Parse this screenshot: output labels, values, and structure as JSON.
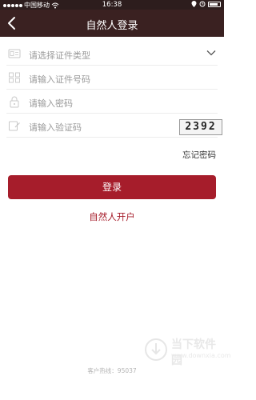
{
  "status_bar": {
    "carrier": "中国移动",
    "time": "16:38"
  },
  "header": {
    "title": "自然人登录"
  },
  "form": {
    "id_type_placeholder": "请选择证件类型",
    "id_number_placeholder": "请输入证件号码",
    "password_placeholder": "请输入密码",
    "captcha_placeholder": "请输入验证码",
    "captcha_code": "2392"
  },
  "links": {
    "forgot_password": "忘记密码",
    "open_account": "自然人开户"
  },
  "buttons": {
    "login": "登录"
  },
  "footer": {
    "hotline": "客户热线：95037"
  },
  "watermark": {
    "title": "当下软件园",
    "url": "www.downxia.com"
  },
  "colors": {
    "header_bg": "#3a2121",
    "accent": "#a61d2b"
  }
}
